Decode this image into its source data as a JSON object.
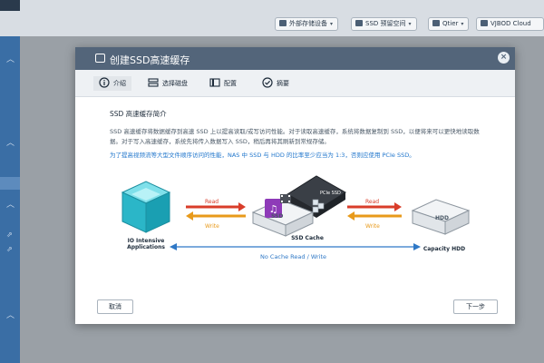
{
  "toolbar": {
    "items": [
      {
        "label": "外部存储设备",
        "icon": "usb-icon"
      },
      {
        "label": "SSD 预留空间",
        "icon": "ssd-icon"
      },
      {
        "label": "Qtier",
        "icon": "qtier-icon"
      },
      {
        "label": "VJBOD Cloud",
        "icon": "cloud-icon"
      }
    ]
  },
  "dialog": {
    "title": "创建SSD高速缓存",
    "close_label": "×",
    "steps": [
      {
        "label": "介绍",
        "icon": "info-icon"
      },
      {
        "label": "选择磁盘",
        "icon": "disk-icon"
      },
      {
        "label": "配置",
        "icon": "config-icon"
      },
      {
        "label": "摘要",
        "icon": "check-icon"
      }
    ],
    "heading": "SSD 高速缓存简介",
    "description": "SSD 高速缓存将数据缓存到高速 SSD 上以提高读取/或写访问性能。对于读取高速缓存，系统将数据复制到 SSD，以便将来可以更快地读取数据。对于写入高速缓存，系统先将传入数据写入 SSD，稍后再将其刷新到常规存储。",
    "note": "为了提高视频流等大型文件顺序访问的性能，NAS 中 SSD 与 HDD 的比率至少应当为 1:3，否则应使用 PCIe SSD。",
    "diagram": {
      "left_label_line1": "IO Intensive",
      "left_label_line2": "Applications",
      "read_label": "Read",
      "write_label": "Write",
      "cache_label": "SSD Cache",
      "ssd_text": "SSD",
      "pcie_text": "PCIe SSD",
      "hdd_text": "HDD",
      "right_label": "Capacity HDD",
      "nocache_label": "No Cache Read / Write",
      "colors": {
        "read": "#d93d2a",
        "write": "#e89a1b",
        "nocache": "#2f78c6",
        "cube": "#2bb6c8"
      }
    },
    "cancel_label": "取消",
    "next_label": "下一步"
  }
}
